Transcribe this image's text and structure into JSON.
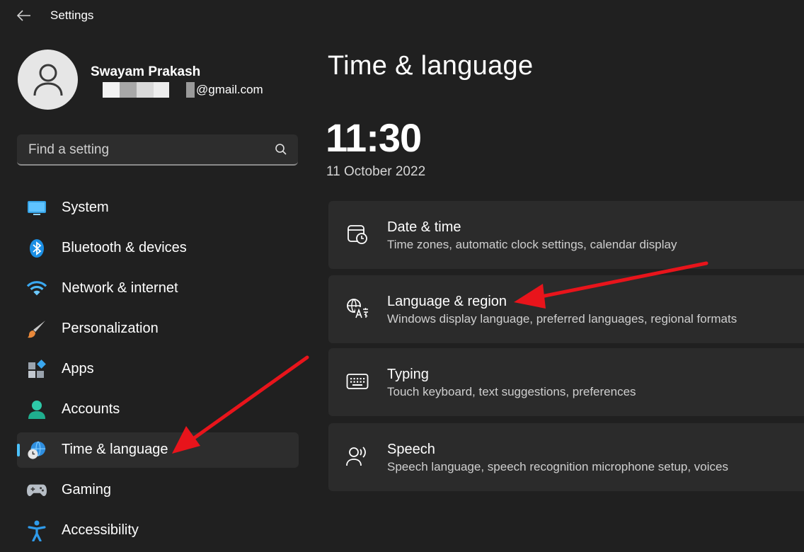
{
  "window": {
    "title": "Settings"
  },
  "profile": {
    "name": "Swayam Prakash",
    "email_suffix": "@gmail.com"
  },
  "search": {
    "placeholder": "Find a setting"
  },
  "sidebar": {
    "items": [
      {
        "label": "System",
        "icon": "monitor-icon"
      },
      {
        "label": "Bluetooth & devices",
        "icon": "bluetooth-icon"
      },
      {
        "label": "Network & internet",
        "icon": "wifi-icon"
      },
      {
        "label": "Personalization",
        "icon": "brush-icon"
      },
      {
        "label": "Apps",
        "icon": "apps-icon"
      },
      {
        "label": "Accounts",
        "icon": "person-icon"
      },
      {
        "label": "Time & language",
        "icon": "globe-clock-icon",
        "selected": true
      },
      {
        "label": "Gaming",
        "icon": "gamepad-icon"
      },
      {
        "label": "Accessibility",
        "icon": "accessibility-icon"
      }
    ]
  },
  "main": {
    "title": "Time & language",
    "clock": "11:30",
    "date": "11 October 2022",
    "cards": [
      {
        "title": "Date & time",
        "description": "Time zones, automatic clock settings, calendar display",
        "icon": "calendar-clock-icon"
      },
      {
        "title": "Language & region",
        "description": "Windows display language, preferred languages, regional formats",
        "icon": "language-icon"
      },
      {
        "title": "Typing",
        "description": "Touch keyboard, text suggestions, preferences",
        "icon": "keyboard-icon"
      },
      {
        "title": "Speech",
        "description": "Speech language, speech recognition microphone setup, voices",
        "icon": "speech-icon"
      }
    ]
  },
  "colors": {
    "background": "#202020",
    "card": "#2b2b2b",
    "accent": "#4cc2ff",
    "annotation_arrow": "#e8141b"
  }
}
